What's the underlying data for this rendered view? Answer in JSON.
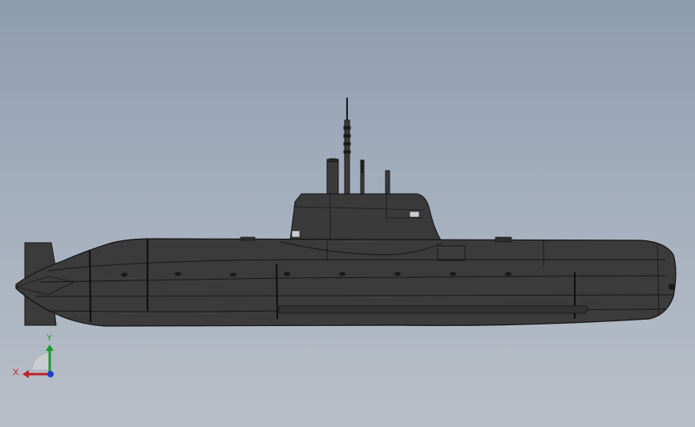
{
  "viewport": {
    "background_top": "#8e9cb0",
    "background_bottom": "#b9bfc7",
    "model": {
      "hull_color": "#3a3a3a",
      "edge_color": "#111111"
    },
    "triad": {
      "x_label": "X",
      "y_label": "Y",
      "x_color": "#c0202a",
      "y_color": "#1a9a2a",
      "z_color": "#1e3fd0"
    }
  }
}
